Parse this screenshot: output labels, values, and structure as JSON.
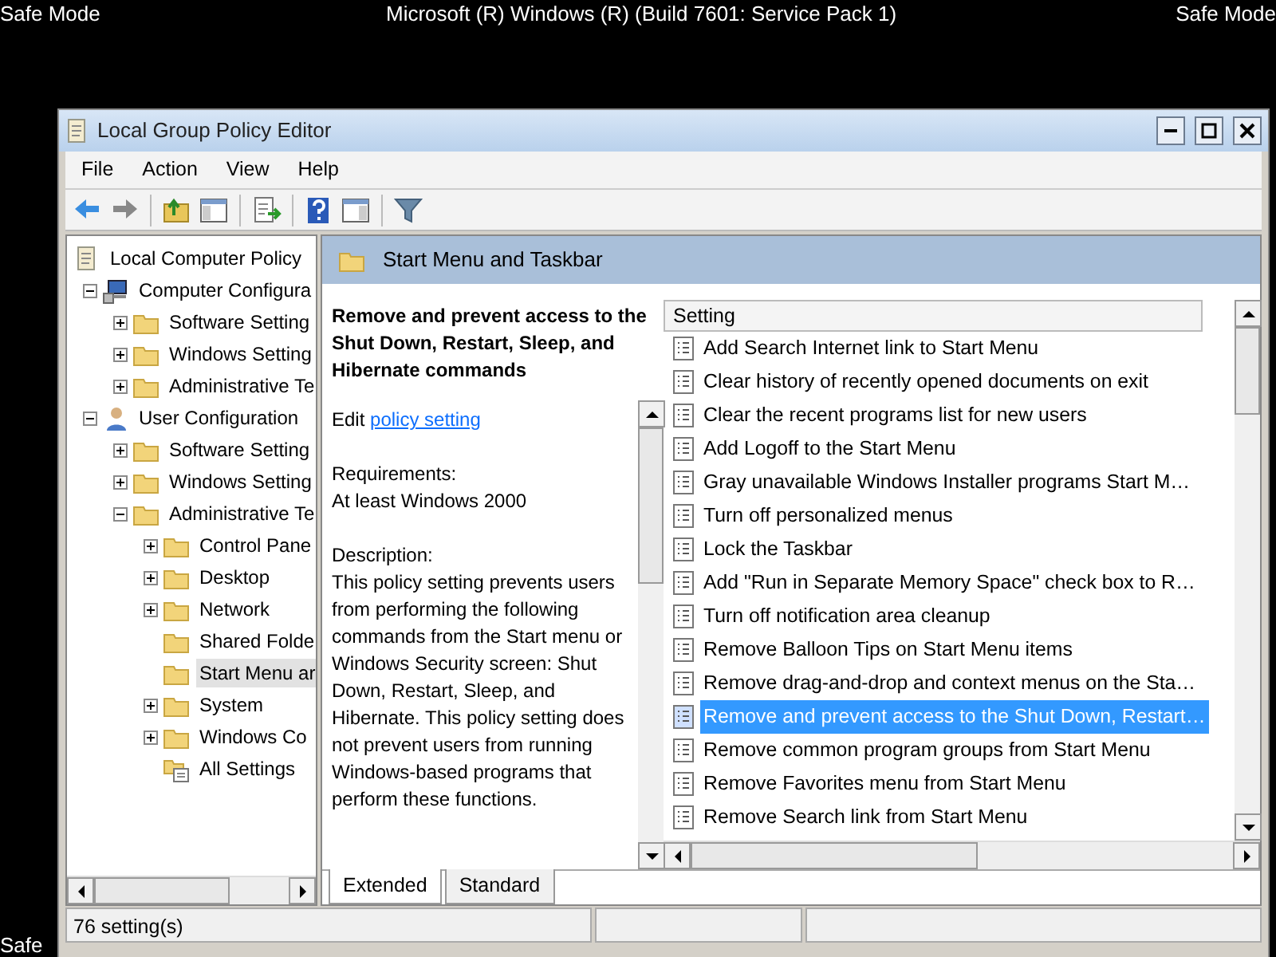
{
  "screen": {
    "top_left": "Safe Mode",
    "top_center": "Microsoft (R) Windows (R) (Build 7601: Service Pack 1)",
    "top_right": "Safe Mode",
    "bottom_left": "Safe"
  },
  "window": {
    "title": "Local Group Policy Editor"
  },
  "menu": [
    "File",
    "Action",
    "View",
    "Help"
  ],
  "toolbar": [
    {
      "kind": "back"
    },
    {
      "kind": "forward"
    },
    {
      "kind": "sep"
    },
    {
      "kind": "up"
    },
    {
      "kind": "tree"
    },
    {
      "kind": "sep"
    },
    {
      "kind": "export"
    },
    {
      "kind": "sep"
    },
    {
      "kind": "help"
    },
    {
      "kind": "pane"
    },
    {
      "kind": "sep"
    },
    {
      "kind": "filter"
    }
  ],
  "tree": [
    {
      "label": "Local Computer Policy",
      "kind": "policy",
      "selected": false,
      "children": [
        {
          "label": "Computer Configura",
          "kind": "computer",
          "expanded": true,
          "selected": false,
          "children": [
            {
              "label": "Software Setting",
              "kind": "folder",
              "expanded": false,
              "selected": false
            },
            {
              "label": "Windows Setting",
              "kind": "folder",
              "expanded": false,
              "selected": false
            },
            {
              "label": "Administrative Te",
              "kind": "folder",
              "expanded": false,
              "selected": false
            }
          ]
        },
        {
          "label": "User Configuration",
          "kind": "user",
          "expanded": true,
          "selected": false,
          "children": [
            {
              "label": "Software Setting",
              "kind": "folder",
              "expanded": false,
              "selected": false
            },
            {
              "label": "Windows Setting",
              "kind": "folder",
              "expanded": false,
              "selected": false
            },
            {
              "label": "Administrative Te",
              "kind": "folder",
              "expanded": true,
              "selected": false,
              "children": [
                {
                  "label": "Control Pane",
                  "kind": "folder",
                  "expanded": false,
                  "selected": false
                },
                {
                  "label": "Desktop",
                  "kind": "folder",
                  "expanded": false,
                  "selected": false
                },
                {
                  "label": "Network",
                  "kind": "folder",
                  "expanded": false,
                  "selected": false
                },
                {
                  "label": "Shared Folde",
                  "kind": "folder",
                  "selected": false
                },
                {
                  "label": "Start Menu ar",
                  "kind": "folder",
                  "selected": true
                },
                {
                  "label": "System",
                  "kind": "folder",
                  "expanded": false,
                  "selected": false
                },
                {
                  "label": "Windows Co",
                  "kind": "folder",
                  "expanded": false,
                  "selected": false
                },
                {
                  "label": "All Settings",
                  "kind": "all",
                  "selected": false
                }
              ]
            }
          ]
        }
      ]
    }
  ],
  "header": {
    "title": "Start Menu and Taskbar"
  },
  "description": {
    "title": "Remove and prevent access to the Shut Down, Restart, Sleep, and Hibernate commands",
    "edit_prefix": "Edit",
    "edit_link": "policy setting",
    "requirements_label": "Requirements:",
    "requirements": "At least Windows 2000",
    "description_label": "Description:",
    "text": "This policy setting prevents users from performing the following commands from the Start menu or Windows Security screen: Shut Down, Restart, Sleep, and Hibernate. This policy setting does not prevent users from running Windows-based programs that perform these functions."
  },
  "settings": {
    "column": "Setting",
    "rows": [
      {
        "label": "Add Search Internet link to Start Menu",
        "selected": false
      },
      {
        "label": "Clear history of recently opened documents on exit",
        "selected": false
      },
      {
        "label": "Clear the recent programs list for new users",
        "selected": false
      },
      {
        "label": "Add Logoff to the Start Menu",
        "selected": false
      },
      {
        "label": "Gray unavailable Windows Installer programs Start M…",
        "selected": false
      },
      {
        "label": "Turn off personalized menus",
        "selected": false
      },
      {
        "label": "Lock the Taskbar",
        "selected": false
      },
      {
        "label": "Add \"Run in Separate Memory Space\" check box to R…",
        "selected": false
      },
      {
        "label": "Turn off notification area cleanup",
        "selected": false
      },
      {
        "label": "Remove Balloon Tips on Start Menu items",
        "selected": false
      },
      {
        "label": "Remove drag-and-drop and context menus on the Sta…",
        "selected": false
      },
      {
        "label": "Remove and prevent access to the Shut Down, Restart…",
        "selected": true
      },
      {
        "label": "Remove common program groups from Start Menu",
        "selected": false
      },
      {
        "label": "Remove Favorites menu from Start Menu",
        "selected": false
      },
      {
        "label": "Remove Search link from Start Menu",
        "selected": false
      }
    ]
  },
  "tabs": [
    {
      "label": "Extended",
      "selected": true
    },
    {
      "label": "Standard",
      "selected": false
    }
  ],
  "status_bar": "76 setting(s)"
}
